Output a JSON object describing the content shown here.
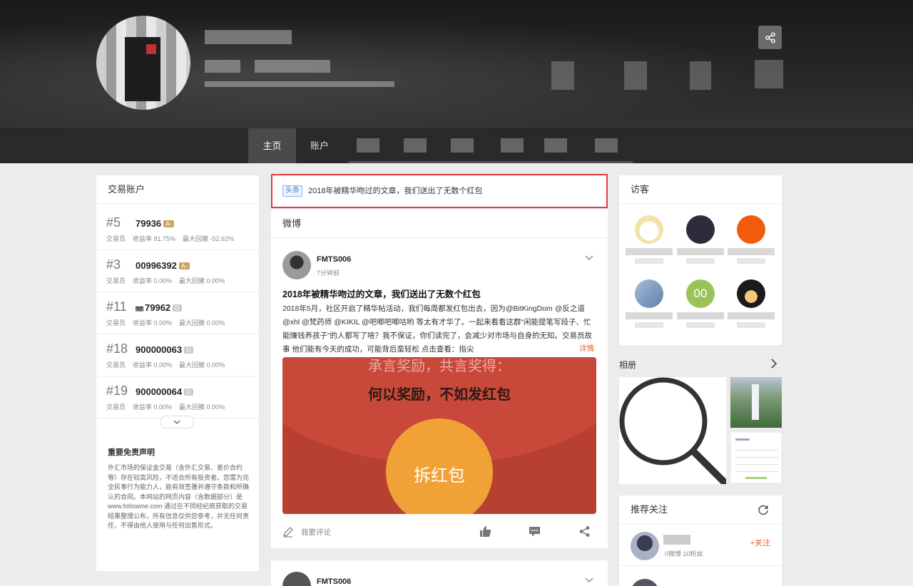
{
  "colors": {
    "accent_orange": "#e8652b",
    "headline_border": "#e23b3b",
    "tag_blue": "#4a7fd4"
  },
  "nav": {
    "tabs": [
      "主页",
      "账户"
    ]
  },
  "left": {
    "title": "交易账户",
    "accounts": [
      {
        "rank": "#5",
        "id": "79936",
        "badge": "A-",
        "role": "交易员",
        "yield": "收益率 81.75%",
        "drawdown": "最大回撤 -52.62%"
      },
      {
        "rank": "#3",
        "id": "00996392",
        "badge": "A-",
        "role": "交易员",
        "yield": "收益率 0.00%",
        "drawdown": "最大回撤 0.00%"
      },
      {
        "rank": "#11",
        "id": "79962",
        "prefix_icon": "㎜",
        "badge": "D",
        "role": "交易员",
        "yield": "收益率 0.00%",
        "drawdown": "最大回撤 0.00%"
      },
      {
        "rank": "#18",
        "id": "900000063",
        "badge": "D",
        "role": "交易员",
        "yield": "收益率 0.00%",
        "drawdown": "最大回撤 0.00%"
      },
      {
        "rank": "#19",
        "id": "900000064",
        "badge": "D",
        "role": "交易员",
        "yield": "收益率 0.00%",
        "drawdown": "最大回撤 0.00%"
      }
    ],
    "disclaimer_title": "重要免责声明",
    "disclaimer_text": "外汇市场的保证金交易（含外汇交易、差价合约等）存在较高风险，不适合所有投资者。您需为完全民事行为能力人，能有效签署并遵守条款和所确认的合同。本网站的网页内容（含数据部分）是 www.followme.com 通过在不同经纪商获取的交易结果整理公布，所有信息仅供您参考，并无任何责任，不得由他人使用与任何出售形式。"
  },
  "headline": {
    "tag": "头条",
    "text": "2018年被精华吻过的文章，我们送出了无数个红包"
  },
  "feed": {
    "title": "微博",
    "post": {
      "author": "FMTS006",
      "time": "7分钟前",
      "title": "2018年被精华吻过的文章，我们送出了无数个红包",
      "body": "2018年5月，社区开启了精华帖活动，我们每周都发红包出去，因为@BitKingDom @反之道 @xhl @梵药师 @KIKIL @吧唧吧唧咕哟 等太有才华了。一起来看看这群“闲能提笔写段子、忙能赚钱养孩子”的人都写了啥？我不保证，你们读完了，会减少对市场与自身的无知。交易员故事 他们能有今天的成功，可能背后蛮轻松 点击查看：指尖",
      "more": "详情",
      "image_caption_top": "承言奖励，共言奖得：",
      "image_caption": "何以奖励，不如发红包",
      "image_coin": "拆红包",
      "comment": "我要评论"
    },
    "next_author": "FMTS006"
  },
  "right": {
    "visitors_title": "访客",
    "visitor_badge": "00",
    "album_title": "相册",
    "rec_title": "推荐关注",
    "rec_meta": "0微博  10粉丝",
    "follow_label": "+关注"
  }
}
